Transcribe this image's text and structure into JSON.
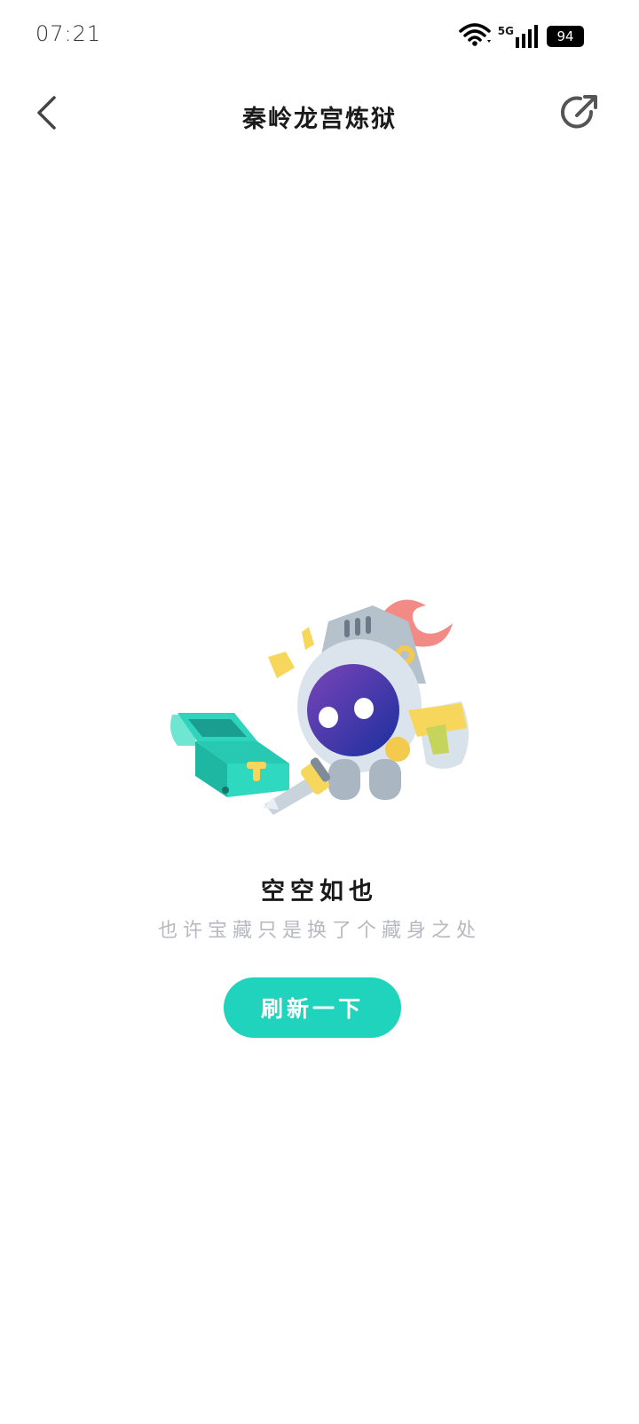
{
  "status_bar": {
    "time": "07:21",
    "network": "5G",
    "battery": "94"
  },
  "header": {
    "title": "秦岭龙宫炼狱"
  },
  "empty_state": {
    "title": "空空如也",
    "subtitle": "也许宝藏只是换了个藏身之处",
    "refresh_label": "刷新一下"
  },
  "colors": {
    "accent": "#1fd3bd",
    "subtitle_gray": "#b7b9c0"
  },
  "icons": {
    "back": "chevron-left-icon",
    "share": "share-arrow-icon",
    "wifi": "wifi-icon",
    "signal": "signal-icon",
    "battery": "battery-icon"
  }
}
